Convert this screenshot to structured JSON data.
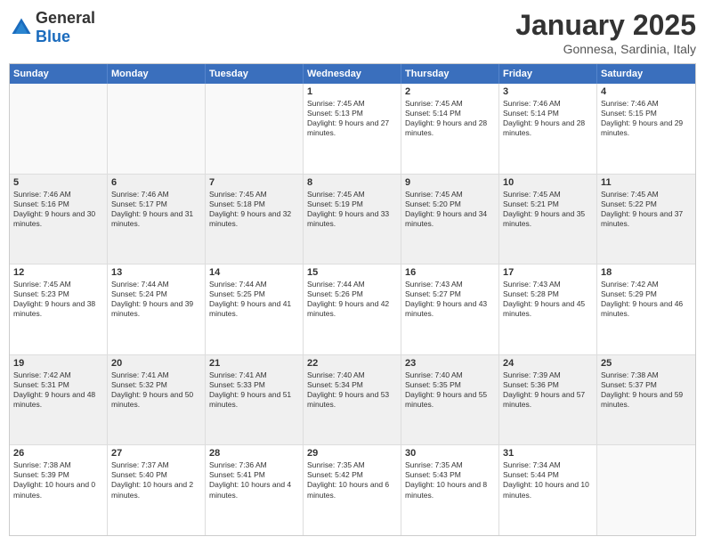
{
  "logo": {
    "general": "General",
    "blue": "Blue"
  },
  "title": "January 2025",
  "subtitle": "Gonnesa, Sardinia, Italy",
  "headers": [
    "Sunday",
    "Monday",
    "Tuesday",
    "Wednesday",
    "Thursday",
    "Friday",
    "Saturday"
  ],
  "rows": [
    [
      {
        "day": "",
        "text": "",
        "empty": true
      },
      {
        "day": "",
        "text": "",
        "empty": true
      },
      {
        "day": "",
        "text": "",
        "empty": true
      },
      {
        "day": "1",
        "text": "Sunrise: 7:45 AM\nSunset: 5:13 PM\nDaylight: 9 hours and 27 minutes.",
        "shaded": false
      },
      {
        "day": "2",
        "text": "Sunrise: 7:45 AM\nSunset: 5:14 PM\nDaylight: 9 hours and 28 minutes.",
        "shaded": false
      },
      {
        "day": "3",
        "text": "Sunrise: 7:46 AM\nSunset: 5:14 PM\nDaylight: 9 hours and 28 minutes.",
        "shaded": false
      },
      {
        "day": "4",
        "text": "Sunrise: 7:46 AM\nSunset: 5:15 PM\nDaylight: 9 hours and 29 minutes.",
        "shaded": false
      }
    ],
    [
      {
        "day": "5",
        "text": "Sunrise: 7:46 AM\nSunset: 5:16 PM\nDaylight: 9 hours and 30 minutes.",
        "shaded": true
      },
      {
        "day": "6",
        "text": "Sunrise: 7:46 AM\nSunset: 5:17 PM\nDaylight: 9 hours and 31 minutes.",
        "shaded": true
      },
      {
        "day": "7",
        "text": "Sunrise: 7:45 AM\nSunset: 5:18 PM\nDaylight: 9 hours and 32 minutes.",
        "shaded": true
      },
      {
        "day": "8",
        "text": "Sunrise: 7:45 AM\nSunset: 5:19 PM\nDaylight: 9 hours and 33 minutes.",
        "shaded": true
      },
      {
        "day": "9",
        "text": "Sunrise: 7:45 AM\nSunset: 5:20 PM\nDaylight: 9 hours and 34 minutes.",
        "shaded": true
      },
      {
        "day": "10",
        "text": "Sunrise: 7:45 AM\nSunset: 5:21 PM\nDaylight: 9 hours and 35 minutes.",
        "shaded": true
      },
      {
        "day": "11",
        "text": "Sunrise: 7:45 AM\nSunset: 5:22 PM\nDaylight: 9 hours and 37 minutes.",
        "shaded": true
      }
    ],
    [
      {
        "day": "12",
        "text": "Sunrise: 7:45 AM\nSunset: 5:23 PM\nDaylight: 9 hours and 38 minutes.",
        "shaded": false
      },
      {
        "day": "13",
        "text": "Sunrise: 7:44 AM\nSunset: 5:24 PM\nDaylight: 9 hours and 39 minutes.",
        "shaded": false
      },
      {
        "day": "14",
        "text": "Sunrise: 7:44 AM\nSunset: 5:25 PM\nDaylight: 9 hours and 41 minutes.",
        "shaded": false
      },
      {
        "day": "15",
        "text": "Sunrise: 7:44 AM\nSunset: 5:26 PM\nDaylight: 9 hours and 42 minutes.",
        "shaded": false
      },
      {
        "day": "16",
        "text": "Sunrise: 7:43 AM\nSunset: 5:27 PM\nDaylight: 9 hours and 43 minutes.",
        "shaded": false
      },
      {
        "day": "17",
        "text": "Sunrise: 7:43 AM\nSunset: 5:28 PM\nDaylight: 9 hours and 45 minutes.",
        "shaded": false
      },
      {
        "day": "18",
        "text": "Sunrise: 7:42 AM\nSunset: 5:29 PM\nDaylight: 9 hours and 46 minutes.",
        "shaded": false
      }
    ],
    [
      {
        "day": "19",
        "text": "Sunrise: 7:42 AM\nSunset: 5:31 PM\nDaylight: 9 hours and 48 minutes.",
        "shaded": true
      },
      {
        "day": "20",
        "text": "Sunrise: 7:41 AM\nSunset: 5:32 PM\nDaylight: 9 hours and 50 minutes.",
        "shaded": true
      },
      {
        "day": "21",
        "text": "Sunrise: 7:41 AM\nSunset: 5:33 PM\nDaylight: 9 hours and 51 minutes.",
        "shaded": true
      },
      {
        "day": "22",
        "text": "Sunrise: 7:40 AM\nSunset: 5:34 PM\nDaylight: 9 hours and 53 minutes.",
        "shaded": true
      },
      {
        "day": "23",
        "text": "Sunrise: 7:40 AM\nSunset: 5:35 PM\nDaylight: 9 hours and 55 minutes.",
        "shaded": true
      },
      {
        "day": "24",
        "text": "Sunrise: 7:39 AM\nSunset: 5:36 PM\nDaylight: 9 hours and 57 minutes.",
        "shaded": true
      },
      {
        "day": "25",
        "text": "Sunrise: 7:38 AM\nSunset: 5:37 PM\nDaylight: 9 hours and 59 minutes.",
        "shaded": true
      }
    ],
    [
      {
        "day": "26",
        "text": "Sunrise: 7:38 AM\nSunset: 5:39 PM\nDaylight: 10 hours and 0 minutes.",
        "shaded": false
      },
      {
        "day": "27",
        "text": "Sunrise: 7:37 AM\nSunset: 5:40 PM\nDaylight: 10 hours and 2 minutes.",
        "shaded": false
      },
      {
        "day": "28",
        "text": "Sunrise: 7:36 AM\nSunset: 5:41 PM\nDaylight: 10 hours and 4 minutes.",
        "shaded": false
      },
      {
        "day": "29",
        "text": "Sunrise: 7:35 AM\nSunset: 5:42 PM\nDaylight: 10 hours and 6 minutes.",
        "shaded": false
      },
      {
        "day": "30",
        "text": "Sunrise: 7:35 AM\nSunset: 5:43 PM\nDaylight: 10 hours and 8 minutes.",
        "shaded": false
      },
      {
        "day": "31",
        "text": "Sunrise: 7:34 AM\nSunset: 5:44 PM\nDaylight: 10 hours and 10 minutes.",
        "shaded": false
      },
      {
        "day": "",
        "text": "",
        "empty": true
      }
    ]
  ]
}
